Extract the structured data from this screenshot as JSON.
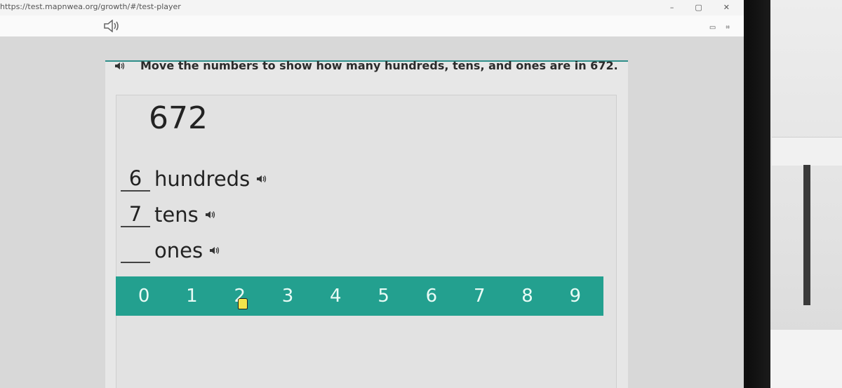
{
  "browser": {
    "url": "https://test.mapnwea.org/growth/#/test-player",
    "controls": [
      "–",
      "▢",
      "✕"
    ]
  },
  "toolbar": {
    "speaker_icon": "speaker-icon",
    "tool_icons": [
      "▭",
      "⌗"
    ]
  },
  "question": {
    "text": "Move the numbers to show how many hundreds, tens, and ones are in 672.",
    "speaker_icon": "speaker-icon"
  },
  "problem": {
    "number": "672",
    "rows": [
      {
        "value": "6",
        "label": "hundreds"
      },
      {
        "value": "7",
        "label": "tens"
      },
      {
        "value": "",
        "label": "ones"
      }
    ]
  },
  "number_tiles": [
    "0",
    "1",
    "2",
    "3",
    "4",
    "5",
    "6",
    "7",
    "8",
    "9"
  ],
  "colors": {
    "tile_bar": "#23a08f",
    "accent_line": "#2f8f8a"
  }
}
